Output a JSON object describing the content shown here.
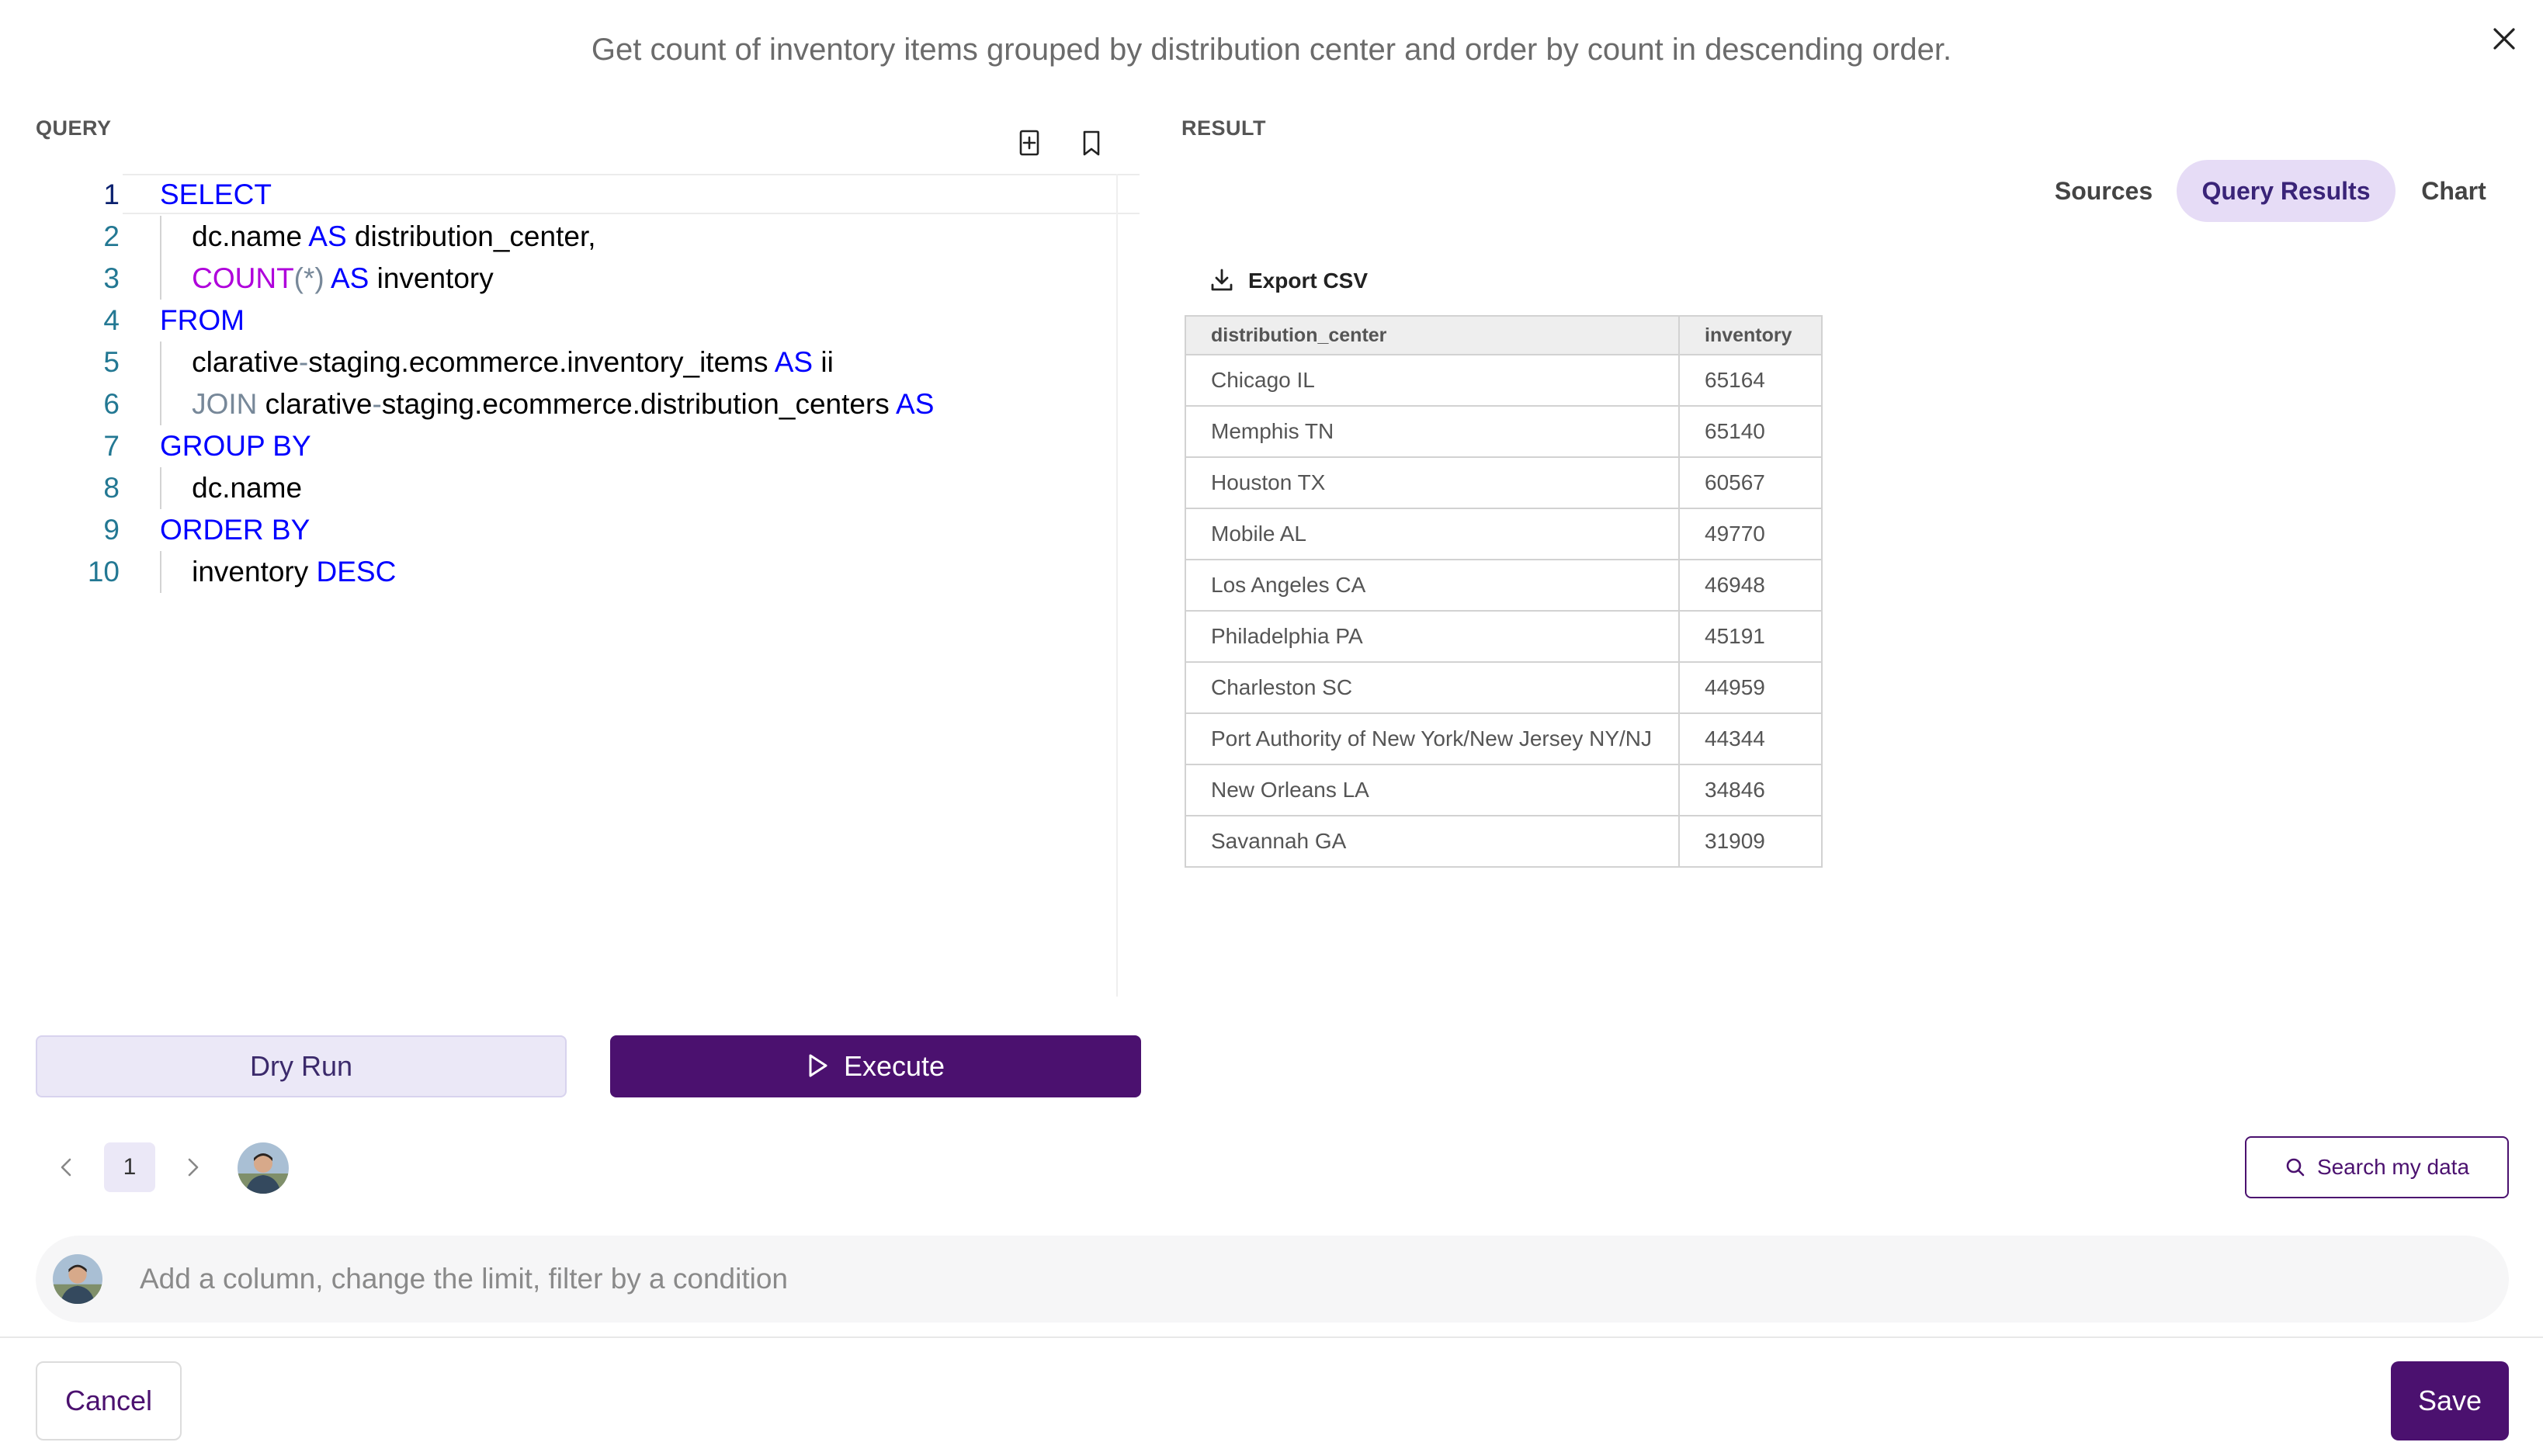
{
  "prompt_title": "Get count of inventory items grouped by distribution center and order by count in descending order.",
  "query_panel": {
    "label": "QUERY",
    "code_lines": [
      {
        "num": "1",
        "tokens": [
          {
            "t": "SELECT",
            "c": "kw"
          }
        ]
      },
      {
        "num": "2",
        "tokens": [
          {
            "t": "    dc.name ",
            "c": ""
          },
          {
            "t": "AS",
            "c": "kw"
          },
          {
            "t": " distribution_center,",
            "c": ""
          }
        ]
      },
      {
        "num": "3",
        "tokens": [
          {
            "t": "    ",
            "c": ""
          },
          {
            "t": "COUNT",
            "c": "fn"
          },
          {
            "t": "(*)",
            "c": "op"
          },
          {
            "t": " ",
            "c": ""
          },
          {
            "t": "AS",
            "c": "kw"
          },
          {
            "t": " inventory",
            "c": ""
          }
        ]
      },
      {
        "num": "4",
        "tokens": [
          {
            "t": "FROM",
            "c": "kw"
          }
        ]
      },
      {
        "num": "5",
        "tokens": [
          {
            "t": "    clarative",
            "c": ""
          },
          {
            "t": "-",
            "c": "op"
          },
          {
            "t": "staging.ecommerce.inventory_items ",
            "c": ""
          },
          {
            "t": "AS",
            "c": "kw"
          },
          {
            "t": " ii",
            "c": ""
          }
        ]
      },
      {
        "num": "6",
        "tokens": [
          {
            "t": "    ",
            "c": ""
          },
          {
            "t": "JOIN",
            "c": "op"
          },
          {
            "t": " clarative",
            "c": ""
          },
          {
            "t": "-",
            "c": "op"
          },
          {
            "t": "staging.ecommerce.distribution_centers ",
            "c": ""
          },
          {
            "t": "AS",
            "c": "kw"
          }
        ]
      },
      {
        "num": "7",
        "tokens": [
          {
            "t": "GROUP BY",
            "c": "kw"
          }
        ]
      },
      {
        "num": "8",
        "tokens": [
          {
            "t": "    dc.name",
            "c": ""
          }
        ]
      },
      {
        "num": "9",
        "tokens": [
          {
            "t": "ORDER BY",
            "c": "kw"
          }
        ]
      },
      {
        "num": "10",
        "tokens": [
          {
            "t": "    inventory ",
            "c": ""
          },
          {
            "t": "DESC",
            "c": "kw"
          }
        ]
      }
    ],
    "dry_run_label": "Dry Run",
    "execute_label": "Execute",
    "page_number": "1"
  },
  "result_panel": {
    "label": "RESULT",
    "tabs": [
      {
        "label": "Sources",
        "active": false
      },
      {
        "label": "Query Results",
        "active": true
      },
      {
        "label": "Chart",
        "active": false
      }
    ],
    "export_label": "Export CSV",
    "columns": [
      "distribution_center",
      "inventory"
    ],
    "rows": [
      [
        "Chicago IL",
        "65164"
      ],
      [
        "Memphis TN",
        "65140"
      ],
      [
        "Houston TX",
        "60567"
      ],
      [
        "Mobile AL",
        "49770"
      ],
      [
        "Los Angeles CA",
        "46948"
      ],
      [
        "Philadelphia PA",
        "45191"
      ],
      [
        "Charleston SC",
        "44959"
      ],
      [
        "Port Authority of New York/New Jersey NY/NJ",
        "44344"
      ],
      [
        "New Orleans LA",
        "34846"
      ],
      [
        "Savannah GA",
        "31909"
      ]
    ]
  },
  "search_button_label": "Search my data",
  "chat": {
    "placeholder": "Add a column, change the limit, filter by a condition",
    "value": ""
  },
  "footer": {
    "cancel_label": "Cancel",
    "save_label": "Save"
  },
  "colors": {
    "primary": "#4b116f",
    "primary_light": "#ebe8f7",
    "tab_active_bg": "#e6dcf6"
  }
}
